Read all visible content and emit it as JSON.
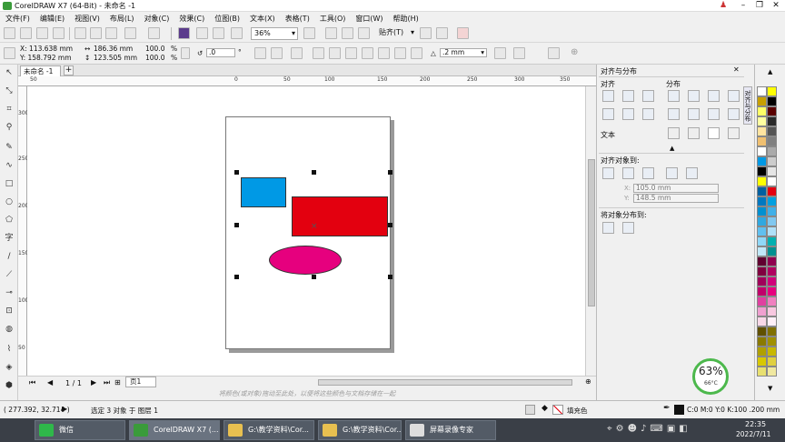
{
  "window": {
    "title": "CorelDRAW X7 (64-Bit) - 未命名 -1"
  },
  "menu": [
    "文件(F)",
    "编辑(E)",
    "视图(V)",
    "布局(L)",
    "对象(C)",
    "效果(C)",
    "位图(B)",
    "文本(X)",
    "表格(T)",
    "工具(O)",
    "窗口(W)",
    "帮助(H)"
  ],
  "toolbar": {
    "zoom": "36%",
    "snap": "贴齐(T)"
  },
  "propbar": {
    "x": "X: 113.638 mm",
    "y": "Y: 158.792 mm",
    "w": "186.36 mm",
    "h": "123.505 mm",
    "sx": "100.0",
    "sy": "100.0",
    "pct1": "%",
    "pct2": "%",
    "angle": ".0",
    "deg": "°",
    "outline": ".2 mm"
  },
  "doc": {
    "tab": "未命名 -1",
    "ruler_h": [
      "50",
      "0",
      "50",
      "100",
      "150",
      "200",
      "250",
      "300",
      "350"
    ],
    "ruler_v": [
      "300",
      "250",
      "200",
      "150",
      "100",
      "50"
    ]
  },
  "pagebar": {
    "pages": "1 / 1",
    "page_tab": "页1"
  },
  "hint": "将颜色(或对象)拖动至此处，以便将这些颜色与文档存储在一起",
  "docker": {
    "title": "对齐与分布",
    "align": "对齐",
    "distribute": "分布",
    "text": "文本",
    "align_to": "对齐对象到:",
    "x_val": "105.0 mm",
    "y_val": "148.5 mm",
    "x_lbl": "X:",
    "y_lbl": "Y:",
    "dist_to": "将对象分布到:",
    "vtab": "对齐与分布"
  },
  "status": {
    "coords": "( 277.392, 32.714 )",
    "selection": "选定 3 对象 于 图层 1",
    "fill": "填充色",
    "outline_info": "C:0 M:0 Y:0 K:100  .200 mm"
  },
  "gauge": {
    "percent": "63%",
    "temp": "66°C"
  },
  "taskbar": {
    "items": [
      "微信",
      "CorelDRAW X7 (...",
      "G:\\教学资料\\Cor...",
      "G:\\教学资料\\Cor...",
      "屏幕录像专家"
    ],
    "time": "22:35",
    "date": "2022/7/11"
  },
  "colors": {
    "blue_rect": "#0099e5",
    "red_rect": "#e3000f",
    "ellipse": "#e6007e",
    "accent": "#4cb84c"
  }
}
